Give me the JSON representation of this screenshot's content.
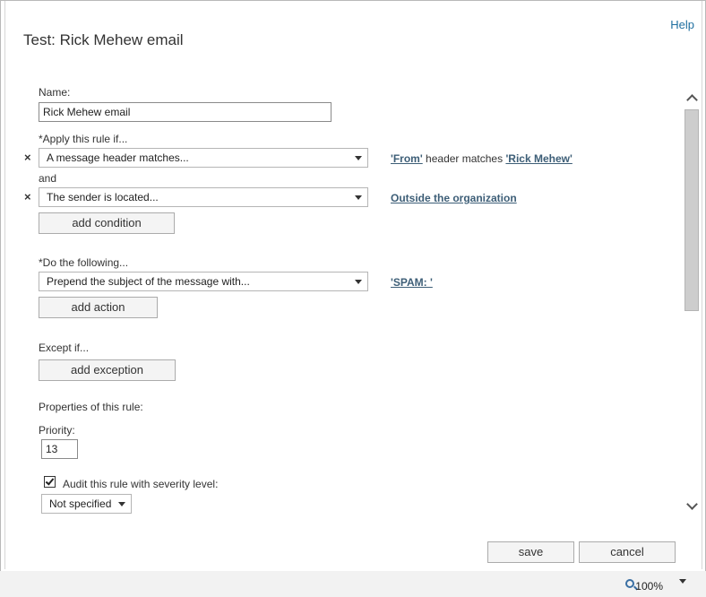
{
  "header": {
    "help": "Help",
    "title": "Test: Rick Mehew email"
  },
  "form": {
    "name_label": "Name:",
    "name_value": "Rick Mehew email",
    "apply_label": "*Apply this rule if...",
    "conditions": [
      {
        "select": "A message header matches...",
        "summary_link1": "'From'",
        "summary_text": " header matches ",
        "summary_link2": "'Rick Mehew'"
      },
      {
        "select": "The sender is located...",
        "summary_link1": "Outside the organization"
      }
    ],
    "and_label": "and",
    "add_condition": "add condition",
    "do_label": "*Do the following...",
    "action_select": "Prepend the subject of the message with...",
    "action_value": "'SPAM: '",
    "add_action": "add action",
    "except_label": "Except if...",
    "add_exception": "add exception",
    "properties_label": "Properties of this rule:",
    "priority_label": "Priority:",
    "priority_value": "13",
    "audit_label": "Audit this rule with severity level:",
    "audit_checked": true,
    "severity_select": "Not specified"
  },
  "footer": {
    "save": "save",
    "cancel": "cancel"
  },
  "status": {
    "zoom": "100%"
  },
  "icons": {
    "remove": "×",
    "zoom": "zoom-icon"
  }
}
